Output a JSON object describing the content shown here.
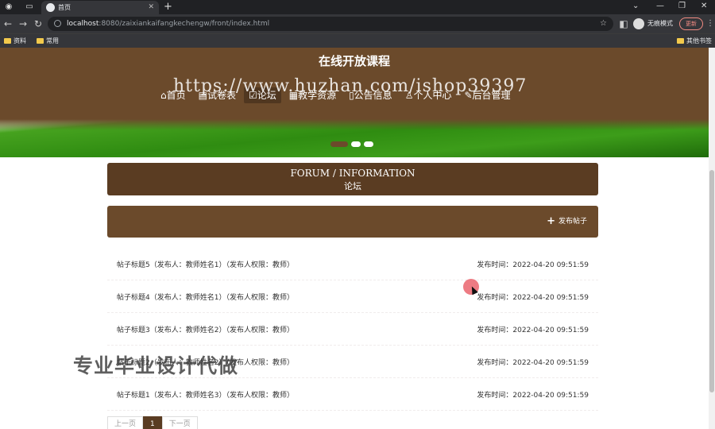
{
  "browser": {
    "tab_title": "首页",
    "url_host": "localhost",
    "url_rest": ":8080/zaixiankaifangkechengw/front/index.html",
    "profile_label": "无痕模式",
    "update_label": "更新",
    "bookmarks": [
      "资料",
      "常用"
    ],
    "other_bookmarks": "其他书签"
  },
  "header": {
    "site_title": "在线开放课程",
    "watermark_url": "https://www.huzhan.com/ishop39397"
  },
  "nav": {
    "items": [
      {
        "label": "⌂首页",
        "active": false
      },
      {
        "label": "▤试卷表",
        "active": false
      },
      {
        "label": "☑论坛",
        "active": true
      },
      {
        "label": "▦教学资源",
        "active": false
      },
      {
        "label": "▯公告信息",
        "active": false
      },
      {
        "label": "♙个人中心",
        "active": false
      },
      {
        "label": "✎后台管理",
        "active": false
      }
    ]
  },
  "banner": {
    "slide_count": 3,
    "active_slide": 0
  },
  "forum": {
    "title_en": "FORUM / INFORMATION",
    "title_cn": "论坛",
    "post_button": "发布帖子"
  },
  "posts": [
    {
      "title": "帖子标题5（发布人：教师姓名1）（发布人权限：教师）",
      "time": "发布时间：2022-04-20 09:51:59"
    },
    {
      "title": "帖子标题4（发布人：教师姓名1）（发布人权限：教师）",
      "time": "发布时间：2022-04-20 09:51:59"
    },
    {
      "title": "帖子标题3（发布人：教师姓名2）（发布人权限：教师）",
      "time": "发布时间：2022-04-20 09:51:59"
    },
    {
      "title": "帖子标题2（发布人：教师姓名2）（发布人权限：教师）",
      "time": "发布时间：2022-04-20 09:51:59"
    },
    {
      "title": "帖子标题1（发布人：教师姓名3）（发布人权限：教师）",
      "time": "发布时间：2022-04-20 09:51:59"
    }
  ],
  "overlay_text": "专业毕业设计代做",
  "pagination": {
    "prev": "上一页",
    "current": "1",
    "next": "下一页"
  }
}
